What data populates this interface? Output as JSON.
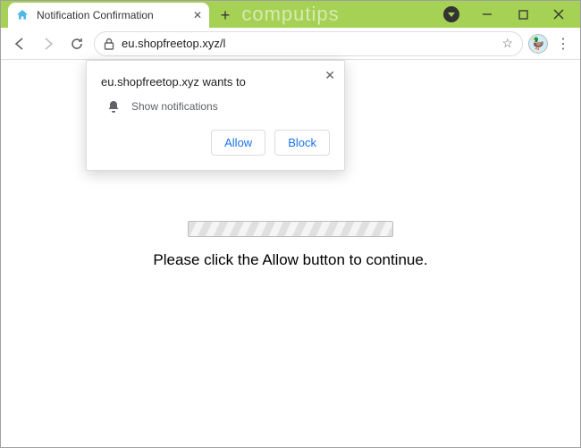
{
  "window": {
    "watermark": "computips"
  },
  "tab": {
    "title": "Notification Confirmation"
  },
  "address": {
    "url": "eu.shopfreetop.xyz/l"
  },
  "permission": {
    "title": "eu.shopfreetop.xyz wants to",
    "item": "Show notifications",
    "allow": "Allow",
    "block": "Block"
  },
  "page": {
    "message": "Please click the Allow button to continue."
  }
}
